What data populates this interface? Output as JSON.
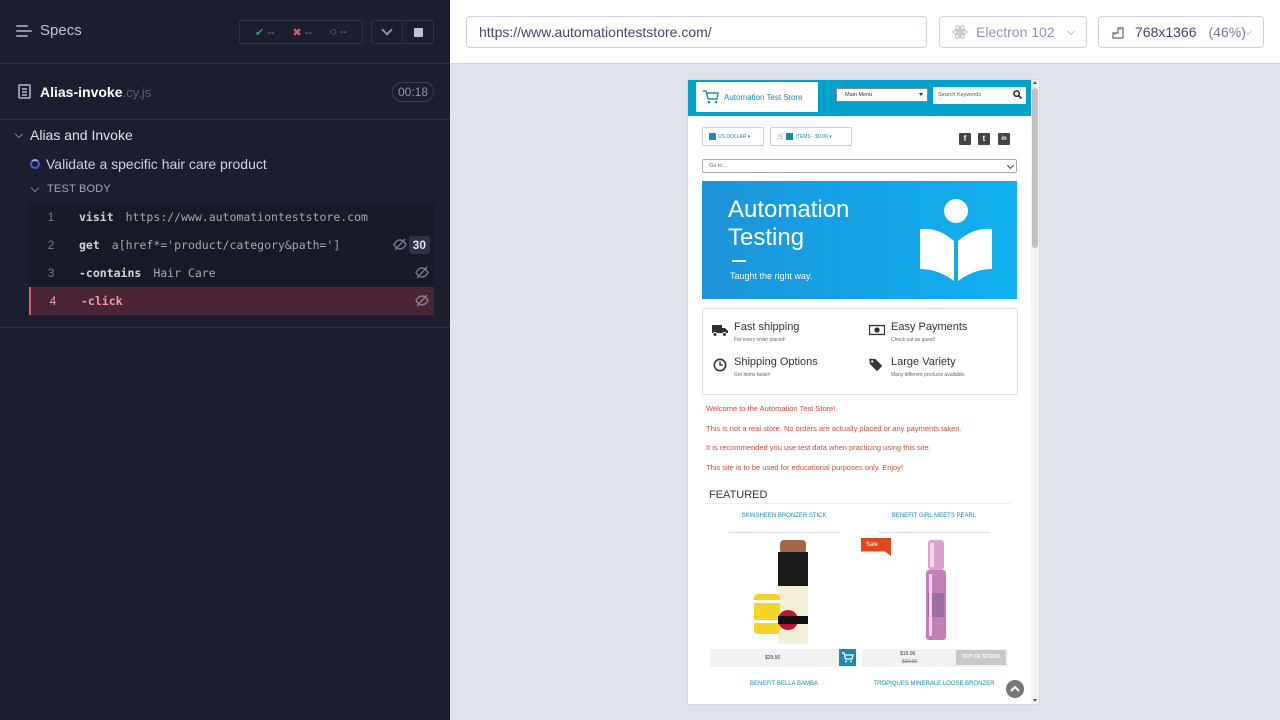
{
  "reporter": {
    "specs_label": "Specs",
    "stats": {
      "passed": "--",
      "failed": "--",
      "pending": "--"
    },
    "file": {
      "name": "Alias-invoke",
      "ext": ".cy.js",
      "duration": "00:18"
    },
    "suite_title": "Alias and Invoke",
    "test_title": "Validate a specific hair care product",
    "body_label": "TEST BODY",
    "commands": [
      {
        "num": "1",
        "name": "visit",
        "arg": "https://www.automationteststore.com"
      },
      {
        "num": "2",
        "name": "get",
        "arg": "a[href*='product/category&path=']",
        "count": "30"
      },
      {
        "num": "3",
        "name": "-contains",
        "arg": "Hair Care"
      },
      {
        "num": "4",
        "name": "-click",
        "arg": ""
      }
    ]
  },
  "aut_header": {
    "url": "https://www.automationteststore.com/",
    "browser": "Electron 102",
    "viewport": "768x1366",
    "zoom": "(46%)"
  },
  "store": {
    "logo_text": "Automation Test Store",
    "main_menu": "Main Menu",
    "search_placeholder": "Search Keywords",
    "currency": "US DOLLAR ▾",
    "cart": "ITEMS - $0.00 ▾",
    "goto": "Go to...",
    "banner": {
      "line1": "Automation",
      "line2": "Testing",
      "tagline": "Taught the right way."
    },
    "features": [
      {
        "title": "Fast shipping",
        "sub": "For every order placed!"
      },
      {
        "title": "Easy Payments",
        "sub": "Check out as guest!"
      },
      {
        "title": "Shipping Options",
        "sub": "Get items faster!"
      },
      {
        "title": "Large Variety",
        "sub": "Many different products available."
      }
    ],
    "messages": [
      "Welcome to the Automation Test Store!",
      "This is not a real store. No orders are actually placed or any payments taken.",
      "It is recommended you use test data when practicing using this site.",
      "This site is to be used for educational purposes only. Enjoy!"
    ],
    "featured_heading": "FEATURED",
    "products": [
      {
        "name": "SKINSHEEN BRONZER STICK",
        "price": "$29.50"
      },
      {
        "name": "BENEFIT GIRL MEETS PEARL",
        "price": "$19.00",
        "old_price": "$30.00",
        "sale": "Sale",
        "status": "OUT OF STOCK"
      },
      {
        "name": "BENEFIT BELLA BAMBA"
      },
      {
        "name": "TROPIQUES MINERALE LOOSE BRONZER"
      }
    ]
  }
}
